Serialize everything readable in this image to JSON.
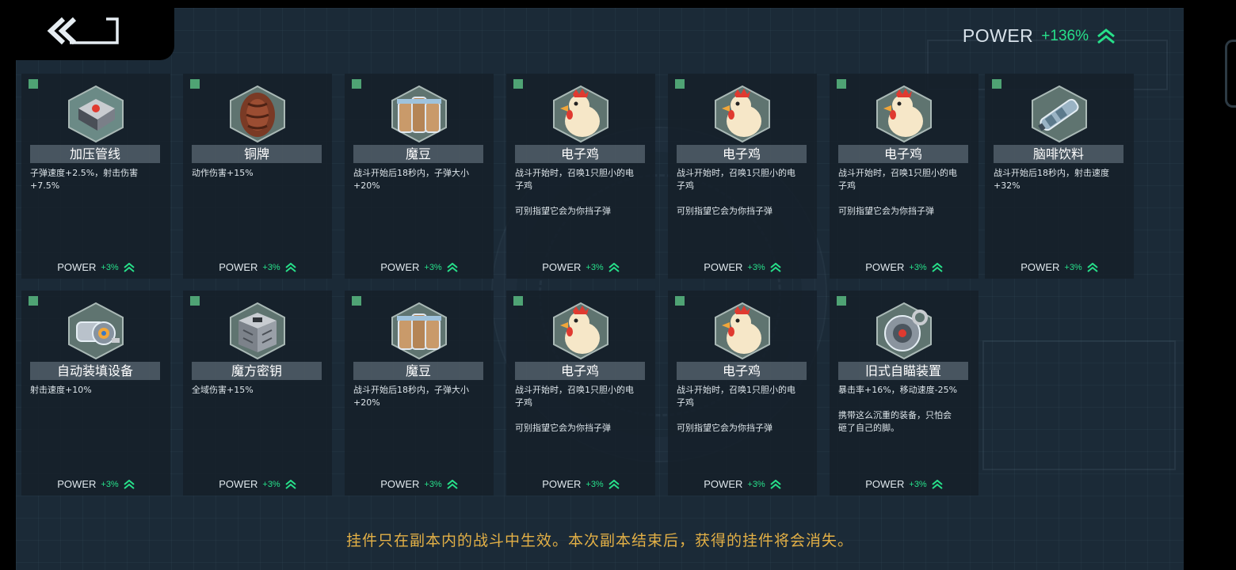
{
  "header": {
    "power_label": "POWER",
    "power_value": "+136%"
  },
  "accent_colors": {
    "power_green": "#27e08a",
    "hint_yellow": "#e3b046",
    "marker_green": "#4fa374"
  },
  "cards": [
    {
      "name": "加压管线",
      "icon": "pressure-pipe-device",
      "desc": "子弹速度+2.5%，射击伤害\n+7.5%",
      "power_label": "POWER",
      "power_value": "+3%"
    },
    {
      "name": "铜牌",
      "icon": "copper-badge",
      "desc": "动作伤害+15%",
      "power_label": "POWER",
      "power_value": "+3%"
    },
    {
      "name": "魔豆",
      "icon": "magic-beans-jars",
      "desc": "战斗开始后18秒内，子弹大小\n+20%",
      "power_label": "POWER",
      "power_value": "+3%"
    },
    {
      "name": "电子鸡",
      "icon": "electronic-chicken",
      "desc": "战斗开始时，召唤1只胆小的电\n子鸡\n\n可别指望它会为你挡子弹",
      "power_label": "POWER",
      "power_value": "+3%"
    },
    {
      "name": "电子鸡",
      "icon": "electronic-chicken",
      "desc": "战斗开始时，召唤1只胆小的电\n子鸡\n\n可别指望它会为你挡子弹",
      "power_label": "POWER",
      "power_value": "+3%"
    },
    {
      "name": "电子鸡",
      "icon": "electronic-chicken",
      "desc": "战斗开始时，召唤1只胆小的电\n子鸡\n\n可别指望它会为你挡子弹",
      "power_label": "POWER",
      "power_value": "+3%"
    },
    {
      "name": "脑啡饮料",
      "icon": "brain-drink-canisters",
      "desc": "战斗开始后18秒内，射击速度\n+32%",
      "power_label": "POWER",
      "power_value": "+3%"
    },
    {
      "name": "自动装填设备",
      "icon": "auto-loader-device",
      "desc": "射击速度+10%",
      "power_label": "POWER",
      "power_value": "+3%"
    },
    {
      "name": "魔方密钥",
      "icon": "cube-key-box",
      "desc": "全域伤害+15%",
      "power_label": "POWER",
      "power_value": "+3%"
    },
    {
      "name": "魔豆",
      "icon": "magic-beans-jars",
      "desc": "战斗开始后18秒内，子弹大小\n+20%",
      "power_label": "POWER",
      "power_value": "+3%"
    },
    {
      "name": "电子鸡",
      "icon": "electronic-chicken",
      "desc": "战斗开始时，召唤1只胆小的电\n子鸡\n\n可别指望它会为你挡子弹",
      "power_label": "POWER",
      "power_value": "+3%"
    },
    {
      "name": "电子鸡",
      "icon": "electronic-chicken",
      "desc": "战斗开始时，召唤1只胆小的电\n子鸡\n\n可别指望它会为你挡子弹",
      "power_label": "POWER",
      "power_value": "+3%"
    },
    {
      "name": "旧式自瞄装置",
      "icon": "old-auto-aim-device",
      "desc": "暴击率+16%，移动速度-25%\n\n携带这么沉重的装备，只怕会\n砸了自己的脚。",
      "power_label": "POWER",
      "power_value": "+3%"
    }
  ],
  "footer": {
    "hint": "挂件只在副本内的战斗中生效。本次副本结束后，获得的挂件将会消失。"
  }
}
